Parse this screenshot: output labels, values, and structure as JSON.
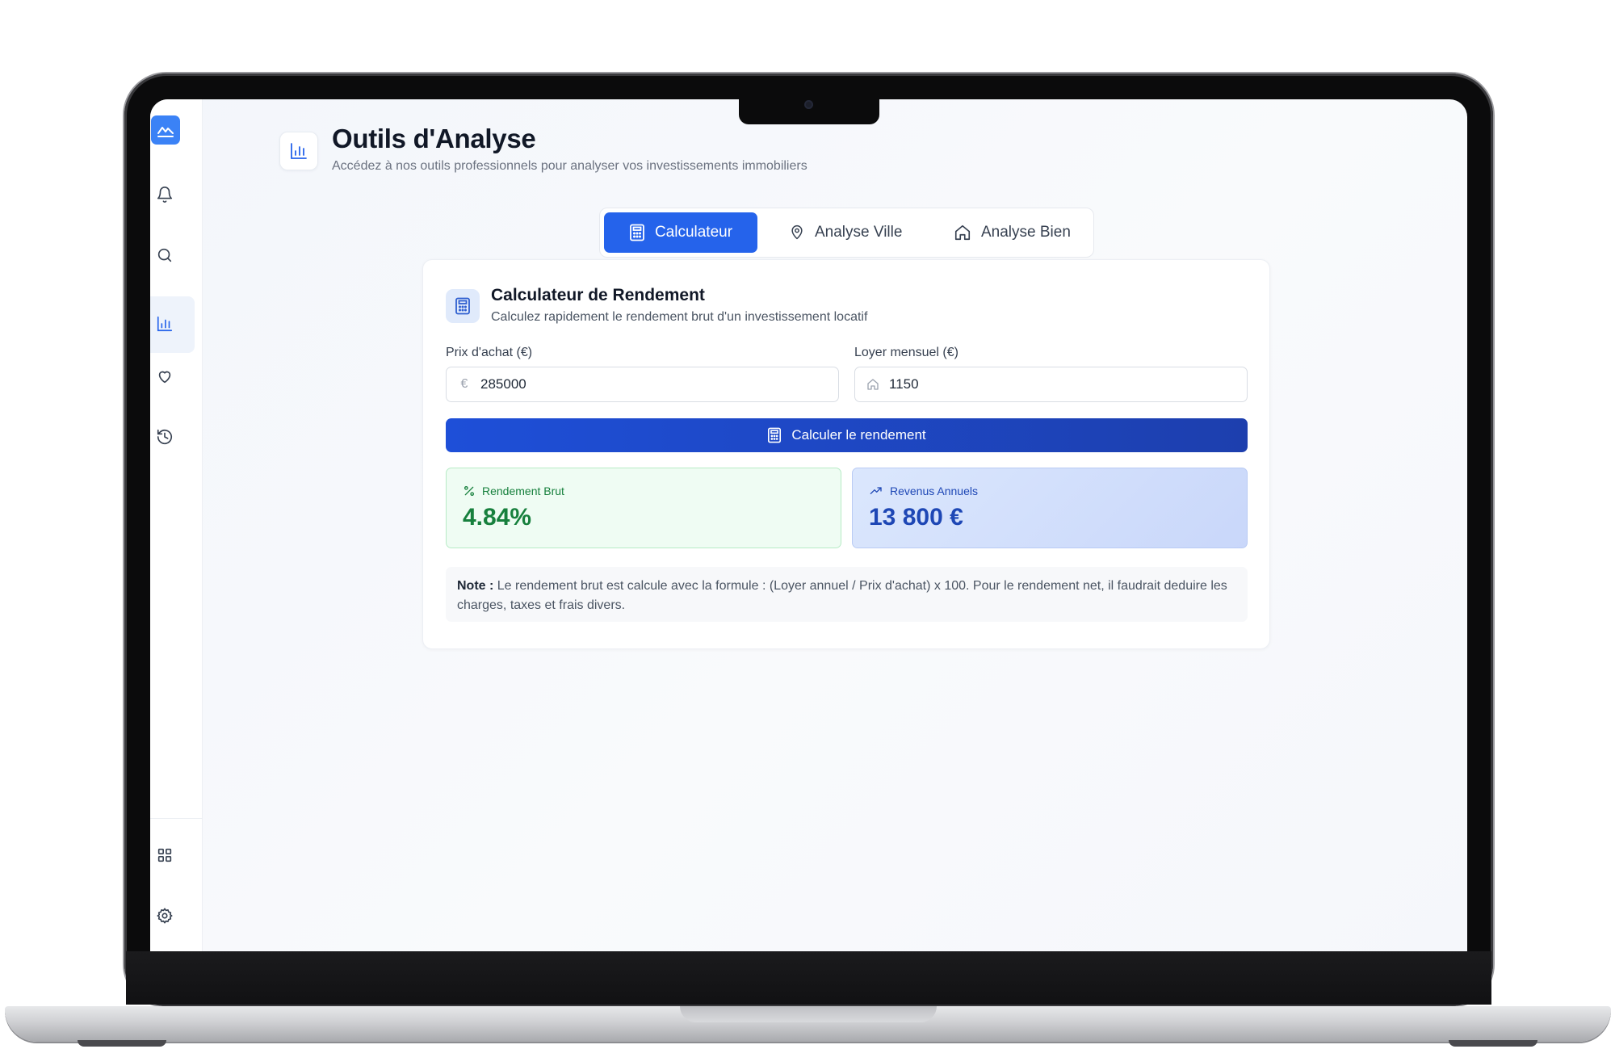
{
  "header": {
    "title": "Outils d'Analyse",
    "subtitle": "Accédez à nos outils professionnels pour analyser vos investissements immobiliers"
  },
  "sidebar": {
    "items": [
      {
        "icon": "bell-icon"
      },
      {
        "icon": "search-icon"
      },
      {
        "icon": "bar-chart-icon",
        "active": true
      },
      {
        "icon": "heart-icon"
      },
      {
        "icon": "history-icon"
      }
    ],
    "bottom_items": [
      {
        "icon": "grid-icon"
      },
      {
        "icon": "gear-icon"
      }
    ]
  },
  "tabs": [
    {
      "label": "Calculateur",
      "icon": "calculator-icon",
      "active": true
    },
    {
      "label": "Analyse Ville",
      "icon": "map-pin-icon"
    },
    {
      "label": "Analyse Bien",
      "icon": "home-icon"
    }
  ],
  "calculator": {
    "title": "Calculateur de Rendement",
    "subtitle": "Calculez rapidement le rendement brut d'un investissement locatif",
    "price_label": "Prix d'achat (€)",
    "price_value": "285000",
    "price_glyph": "€",
    "rent_label": "Loyer mensuel (€)",
    "rent_value": "1150",
    "button_label": "Calculer le rendement",
    "results": {
      "gross_label": "Rendement Brut",
      "gross_value": "4.84%",
      "annual_label": "Revenus Annuels",
      "annual_value": "13 800 €"
    },
    "note_bold": "Note :",
    "note_text": " Le rendement brut est calcule avec la formule : (Loyer annuel / Prix d'achat) x 100. Pour le rendement net, il faudrait deduire les charges, taxes et frais divers."
  },
  "colors": {
    "accent": "#2563eb",
    "success": "#17803d",
    "info": "#1e47b5"
  }
}
